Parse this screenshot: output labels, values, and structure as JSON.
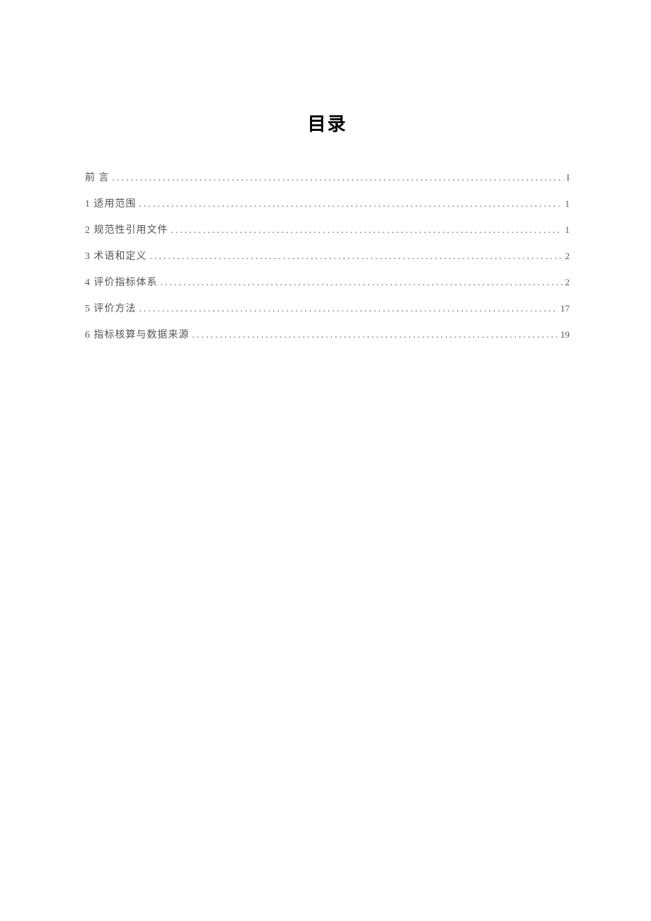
{
  "title": "目录",
  "toc": [
    {
      "label": "前 言",
      "page": "I"
    },
    {
      "label": "1 适用范围",
      "page": "1"
    },
    {
      "label": "2 规范性引用文件",
      "page": "1"
    },
    {
      "label": "3 术语和定义",
      "page": "2"
    },
    {
      "label": "4 评价指标体系",
      "page": "2"
    },
    {
      "label": "5 评价方法",
      "page": "17"
    },
    {
      "label": "6 指标核算与数据来源",
      "page": "19"
    }
  ]
}
